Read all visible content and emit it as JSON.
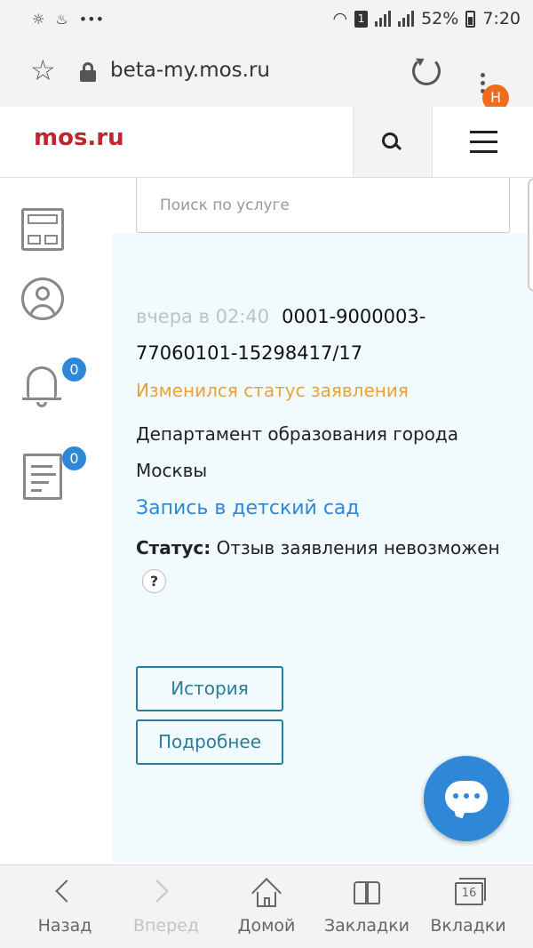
{
  "status_bar": {
    "left_icons": [
      "weather-icon",
      "notification-icon",
      "more-icon"
    ],
    "battery": "52%",
    "time": "7:20",
    "sim": "1"
  },
  "browser": {
    "url": "beta-my.mos.ru",
    "profile_initial": "Н"
  },
  "site": {
    "logo": "mos.ru",
    "brand_color": "#c0262f"
  },
  "search": {
    "placeholder": "Поиск по услуге"
  },
  "sidebar": {
    "items": [
      {
        "icon": "dashboard-icon"
      },
      {
        "icon": "user-icon"
      },
      {
        "icon": "bell-icon",
        "badge": "0"
      },
      {
        "icon": "document-icon",
        "badge": "0"
      }
    ]
  },
  "application": {
    "time": "вчера в 02:40",
    "number": "0001-9000003-77060101-15298417/17",
    "status_change": "Изменился статус заявления",
    "department": "Департамент образования города Москвы",
    "service": "Запись в детский сад",
    "status_label": "Статус:",
    "status_value": "Отзыв заявления невозможен",
    "help": "?"
  },
  "buttons": {
    "history": "История",
    "details": "Подробнее"
  },
  "bottom_nav": {
    "items": [
      {
        "label": "Назад",
        "icon": "chevron-left-icon",
        "enabled": true
      },
      {
        "label": "Вперед",
        "icon": "chevron-right-icon",
        "enabled": false
      },
      {
        "label": "Домой",
        "icon": "home-icon",
        "enabled": true
      },
      {
        "label": "Закладки",
        "icon": "bookmarks-icon",
        "enabled": true
      },
      {
        "label": "Вкладки",
        "icon": "tabs-icon",
        "enabled": true,
        "count": "16"
      }
    ]
  },
  "colors": {
    "accent_blue": "#2f87d8",
    "status_orange": "#e8a23a",
    "button_teal": "#2a7d9c",
    "panel_bg": "#f1fafc"
  }
}
